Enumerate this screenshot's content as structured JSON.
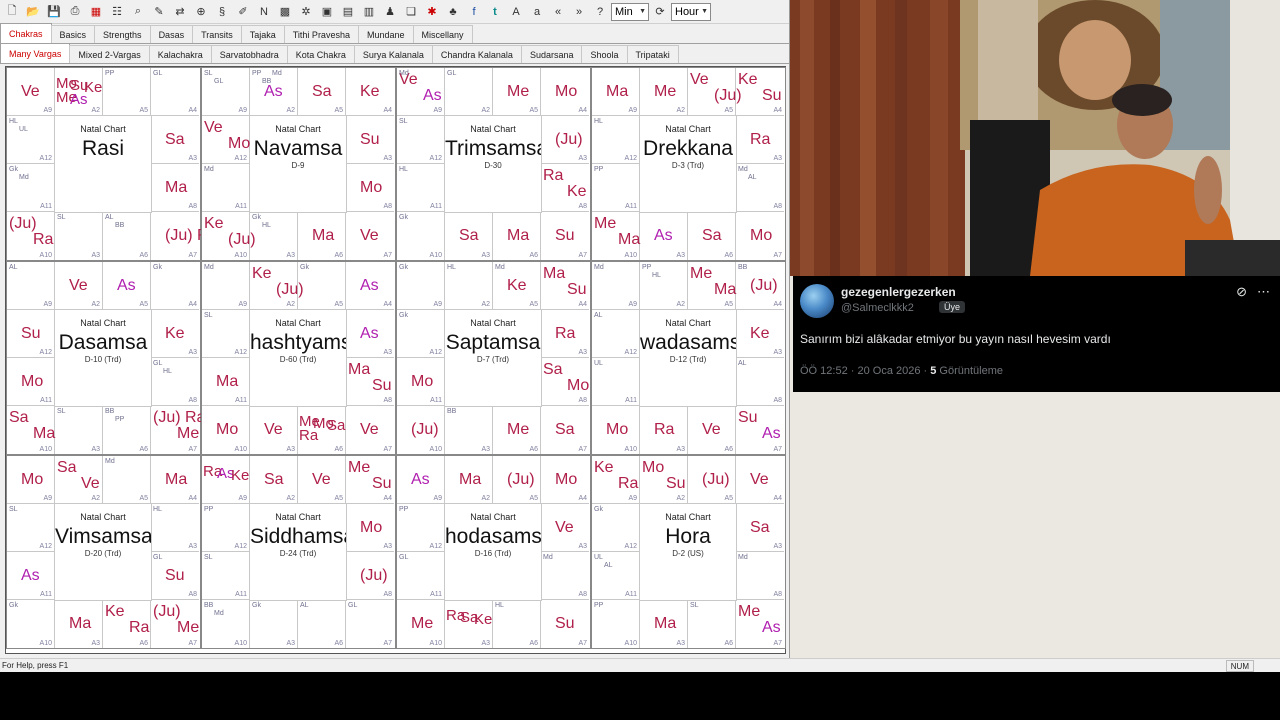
{
  "toolbar": {
    "icons": [
      "new-icon",
      "open-icon",
      "save-icon",
      "print-icon",
      "chart-icon",
      "data-icon",
      "search-icon",
      "edit-icon",
      "transit-icon",
      "globe-icon",
      "sp-icon",
      "pen-icon",
      "n-icon",
      "grid-icon",
      "settings-icon",
      "sh-icon",
      "table-icon",
      "layout-icon",
      "people-icon",
      "book-icon",
      "star-icon",
      "tree-icon",
      "facebook-icon",
      "twitter-icon",
      "font-large-icon",
      "font-small-icon",
      "back-icon",
      "forward-icon",
      "help-icon",
      "refresh-icon"
    ],
    "select1": "Min",
    "select2": "Hour"
  },
  "tabs1": [
    "Chakras",
    "Basics",
    "Strengths",
    "Dasas",
    "Transits",
    "Tajaka",
    "Tithi Pravesha",
    "Mundane",
    "Miscellany"
  ],
  "tabs2": [
    "Many Vargas",
    "Mixed 2-Vargas",
    "Kalachakra",
    "Sarvatobhadra",
    "Kota Chakra",
    "Surya Kalanala",
    "Chandra Kalanala",
    "Sudarsana",
    "Shoola",
    "Tripataki"
  ],
  "charts": [
    {
      "title": "Natal Chart",
      "name": "Rasi",
      "div": "",
      "cells": [
        [
          "Ve"
        ],
        [
          "Mo",
          "Su",
          "Ke",
          "Me",
          "As"
        ],
        [
          "PP"
        ],
        [
          "GL"
        ],
        [
          "Sa"
        ],
        [
          "Ma"
        ],
        [
          "(Ju) Ra"
        ],
        [
          "AL",
          "BB"
        ],
        [
          "SL"
        ],
        [
          "(Ju)",
          "Ra"
        ],
        [
          "Gk",
          "Md"
        ],
        [
          "HL",
          "UL"
        ]
      ]
    },
    {
      "title": "Natal Chart",
      "name": "Navamsa",
      "div": "D-9",
      "cells": [
        [
          "SL",
          "GL"
        ],
        [
          "PP",
          "BB",
          "Md",
          "As"
        ],
        [
          "Sa"
        ],
        [
          "Ke"
        ],
        [
          "Su"
        ],
        [
          "Mo"
        ],
        [
          "Ve"
        ],
        [
          "Ma"
        ],
        [
          "Gk",
          "HL"
        ],
        [
          "Ke",
          "(Ju)"
        ],
        [
          "Md"
        ],
        [
          "Ve",
          "Mo"
        ]
      ]
    },
    {
      "title": "Natal Chart",
      "name": "Trimsamsa",
      "div": "D-30",
      "cells": [
        [
          "Ve",
          "Md",
          "As"
        ],
        [
          "GL"
        ],
        [
          "Me"
        ],
        [
          "Mo"
        ],
        [
          "(Ju)"
        ],
        [
          "Ra",
          "Ke"
        ],
        [
          "Su"
        ],
        [
          "Ma"
        ],
        [
          "Sa"
        ],
        [
          "Gk"
        ],
        [
          "HL"
        ],
        [
          "SL"
        ]
      ]
    },
    {
      "title": "Natal Chart",
      "name": "Drekkana",
      "div": "D-3 (Trd)",
      "cells": [
        [
          "Ma"
        ],
        [
          "Me"
        ],
        [
          "Ve",
          "(Ju)"
        ],
        [
          "Ke",
          "Su"
        ],
        [
          "Ra"
        ],
        [
          "Md",
          "AL"
        ],
        [
          "Mo"
        ],
        [
          "Sa"
        ],
        [
          "As"
        ],
        [
          "Me",
          "Ma"
        ],
        [
          "PP"
        ],
        [
          "HL"
        ]
      ]
    },
    {
      "title": "Natal Chart",
      "name": "Dasamsa",
      "div": "D-10 (Trd)",
      "cells": [
        [
          "AL"
        ],
        [
          "Ve"
        ],
        [
          "As"
        ],
        [
          "Gk"
        ],
        [
          "Ke"
        ],
        [
          "GL",
          "HL"
        ],
        [
          "(Ju) Ra",
          "Me"
        ],
        [
          "BB",
          "PP"
        ],
        [
          "SL"
        ],
        [
          "Sa",
          "Ma"
        ],
        [
          "Mo"
        ],
        [
          "Su"
        ]
      ]
    },
    {
      "title": "Natal Chart",
      "name": "hashtyams",
      "div": "D-60 (Trd)",
      "cells": [
        [
          "Md"
        ],
        [
          "Ke",
          "(Ju)"
        ],
        [
          "Gk"
        ],
        [
          "As"
        ],
        [
          "As"
        ],
        [
          "Ma",
          "Su"
        ],
        [
          "Ve"
        ],
        [
          "Me",
          "Mo",
          "Sa",
          "Ra"
        ],
        [
          "Ve"
        ],
        [
          "Mo"
        ],
        [
          "Ma"
        ],
        [
          "SL"
        ]
      ]
    },
    {
      "title": "Natal Chart",
      "name": "Saptamsa",
      "div": "D-7 (Trd)",
      "cells": [
        [
          "Gk"
        ],
        [
          "HL"
        ],
        [
          "Md",
          "Ke"
        ],
        [
          "Ma",
          "Su"
        ],
        [
          "Ra"
        ],
        [
          "Sa",
          "Mo"
        ],
        [
          "Sa"
        ],
        [
          "Me"
        ],
        [
          "BB"
        ],
        [
          "(Ju)"
        ],
        [
          "Mo"
        ],
        [
          "Gk"
        ]
      ]
    },
    {
      "title": "Natal Chart",
      "name": "wadasams",
      "div": "D-12 (Trd)",
      "cells": [
        [
          "Md"
        ],
        [
          "PP",
          "HL"
        ],
        [
          "Me",
          "Ma"
        ],
        [
          "BB",
          "(Ju)"
        ],
        [
          "Ke"
        ],
        [
          "AL"
        ],
        [
          "Su",
          "As"
        ],
        [
          "Ve"
        ],
        [
          "Ra"
        ],
        [
          "Mo"
        ],
        [
          "UL"
        ],
        [
          "AL"
        ]
      ]
    },
    {
      "title": "Natal Chart",
      "name": "Vimsamsa",
      "div": "D-20 (Trd)",
      "cells": [
        [
          "Mo"
        ],
        [
          "Sa",
          "Ve"
        ],
        [
          "Md"
        ],
        [
          "Ma"
        ],
        [
          "HL"
        ],
        [
          "GL",
          "Su"
        ],
        [
          "(Ju)",
          "Me"
        ],
        [
          "Ke",
          "Ra"
        ],
        [
          "Ma"
        ],
        [
          "Gk"
        ],
        [
          "As"
        ],
        [
          "SL"
        ]
      ]
    },
    {
      "title": "Natal Chart",
      "name": "Siddhamsa",
      "div": "D-24 (Trd)",
      "cells": [
        [
          "Ra",
          "As",
          "Ke"
        ],
        [
          "Sa"
        ],
        [
          "Ve"
        ],
        [
          "Me",
          "Su"
        ],
        [
          "Mo"
        ],
        [
          "(Ju)"
        ],
        [
          "GL"
        ],
        [
          "AL"
        ],
        [
          "Gk"
        ],
        [
          "BB",
          "Md"
        ],
        [
          "SL"
        ],
        [
          "PP"
        ]
      ]
    },
    {
      "title": "Natal Chart",
      "name": "hodasams",
      "div": "D-16 (Trd)",
      "cells": [
        [
          "As"
        ],
        [
          "Ma"
        ],
        [
          "(Ju)"
        ],
        [
          "Mo"
        ],
        [
          "Ve"
        ],
        [
          "Md"
        ],
        [
          "Su"
        ],
        [
          "HL"
        ],
        [
          "Ra",
          "Sa",
          "Ke"
        ],
        [
          "Me"
        ],
        [
          "GL"
        ],
        [
          "PP"
        ]
      ]
    },
    {
      "title": "Natal Chart",
      "name": "Hora",
      "div": "D-2 (US)",
      "cells": [
        [
          "Ke",
          "Ra"
        ],
        [
          "Mo",
          "Su"
        ],
        [
          "(Ju)"
        ],
        [
          "Ve"
        ],
        [
          "Sa"
        ],
        [
          "Md"
        ],
        [
          "Me",
          "As"
        ],
        [
          "SL"
        ],
        [
          "Ma"
        ],
        [
          "PP"
        ],
        [
          "UL",
          "AL"
        ],
        [
          "Gk"
        ]
      ]
    }
  ],
  "status": {
    "help": "For Help, press F1",
    "num": "NUM"
  },
  "tweet": {
    "name": "gezegenlergezerken",
    "handle": "@Salmeclkkk2",
    "badge": "Üye",
    "text": "Sanırım bizi alâkadar etmiyor bu yayın nasıl hevesim vardı",
    "time": "ÖÖ 12:52 · 20 Oca 2026 · ",
    "views": "5",
    "views_label": " Görüntüleme"
  }
}
